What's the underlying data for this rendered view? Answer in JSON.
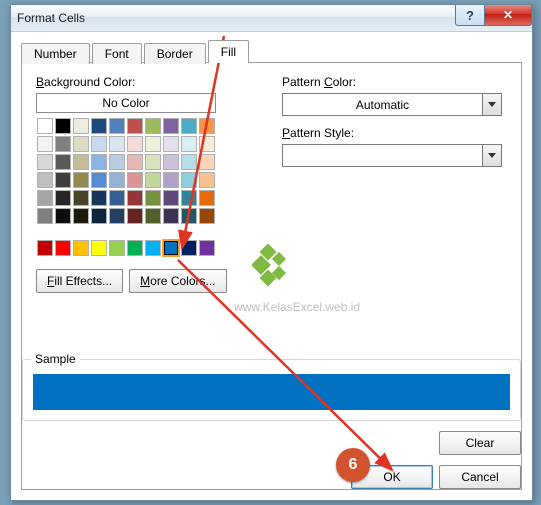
{
  "window": {
    "title": "Format Cells"
  },
  "tabs": {
    "number": "Number",
    "font": "Font",
    "border": "Border",
    "fill": "Fill"
  },
  "fill": {
    "bgcolor_label": "Background Color:",
    "nocolor": "No Color",
    "fill_effects": "Fill Effects...",
    "more_colors": "More Colors...",
    "theme_colors": [
      [
        "#ffffff",
        "#000000",
        "#eeece1",
        "#1f497d",
        "#4f81bd",
        "#c0504d",
        "#9bbb59",
        "#8064a2",
        "#4bacc6",
        "#f79646"
      ],
      [
        "#f2f2f2",
        "#7f7f7f",
        "#ddd9c3",
        "#c6d9f0",
        "#dbe5f1",
        "#f2dcdb",
        "#ebf1dd",
        "#e5e0ec",
        "#dbeef3",
        "#fdeada"
      ],
      [
        "#d8d8d8",
        "#595959",
        "#c4bd97",
        "#8db3e2",
        "#b8cce4",
        "#e5b9b7",
        "#d7e3bc",
        "#ccc1d9",
        "#b7dde8",
        "#fbd5b5"
      ],
      [
        "#bfbfbf",
        "#3f3f3f",
        "#938953",
        "#548dd4",
        "#95b3d7",
        "#d99694",
        "#c3d69b",
        "#b2a2c7",
        "#92cddc",
        "#fac08f"
      ],
      [
        "#a5a5a5",
        "#262626",
        "#494429",
        "#17365d",
        "#366092",
        "#953734",
        "#76923c",
        "#5f497a",
        "#31859b",
        "#e36c09"
      ],
      [
        "#7f7f7f",
        "#0c0c0c",
        "#1d1b10",
        "#0f243e",
        "#244061",
        "#632423",
        "#4f6128",
        "#3f3151",
        "#205867",
        "#974806"
      ]
    ],
    "standard_colors": [
      "#c00000",
      "#ff0000",
      "#ffc000",
      "#ffff00",
      "#92d050",
      "#00b050",
      "#00b0f0",
      "#0070c0",
      "#002060",
      "#7030a0"
    ],
    "selected_standard_index": 7
  },
  "pattern": {
    "color_label": "Pattern Color:",
    "color_value": "Automatic",
    "style_label": "Pattern Style:"
  },
  "sample": {
    "label": "Sample",
    "color": "#0070c0"
  },
  "buttons": {
    "clear": "Clear",
    "ok": "OK",
    "cancel": "Cancel"
  },
  "watermark": "www.KelasExcel.web.id",
  "annotation": {
    "step": "6"
  }
}
